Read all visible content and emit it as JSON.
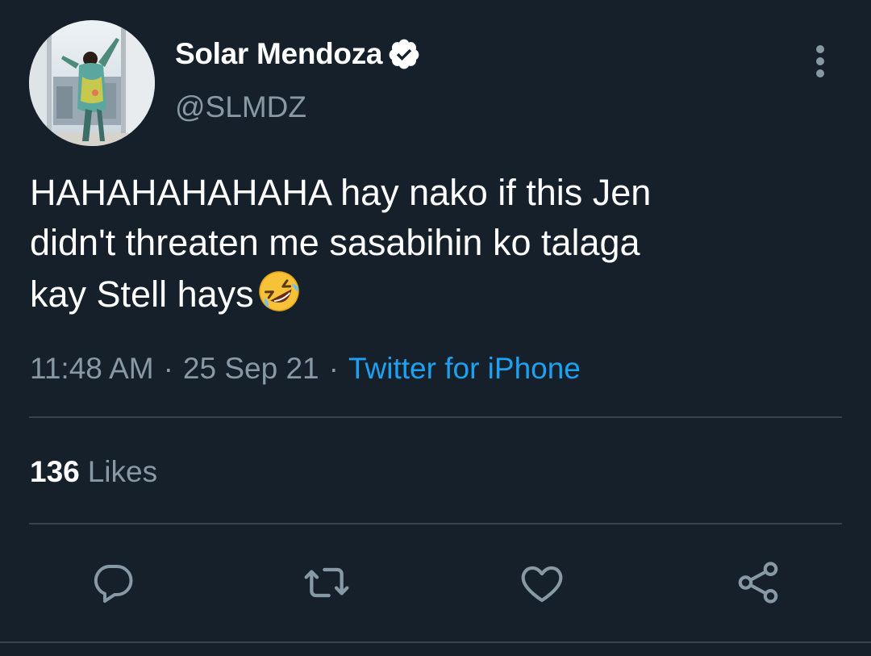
{
  "author": {
    "display_name": "Solar Mendoza",
    "handle": "@SLMDZ",
    "verified": true,
    "avatar_icon": "profile-photo"
  },
  "tweet": {
    "text_lines": [
      "HAHAHAHAHAHA hay nako if this Jen",
      "didn't threaten me sasabihin ko talaga",
      "kay Stell hays"
    ],
    "emoji": "rolling-on-the-floor-laughing-emoji",
    "time": "11:48 AM",
    "date": "25 Sep 21",
    "separator": "·",
    "source": "Twitter for iPhone"
  },
  "stats": {
    "likes_count": "136",
    "likes_label": "Likes"
  },
  "actions": [
    {
      "icon": "reply-icon"
    },
    {
      "icon": "retweet-icon"
    },
    {
      "icon": "like-icon"
    },
    {
      "icon": "share-icon"
    }
  ],
  "colors": {
    "background": "#15202b",
    "primary_text": "#ffffff",
    "secondary_text": "#8899a6",
    "link": "#1da1f2",
    "divider": "#38444d"
  }
}
